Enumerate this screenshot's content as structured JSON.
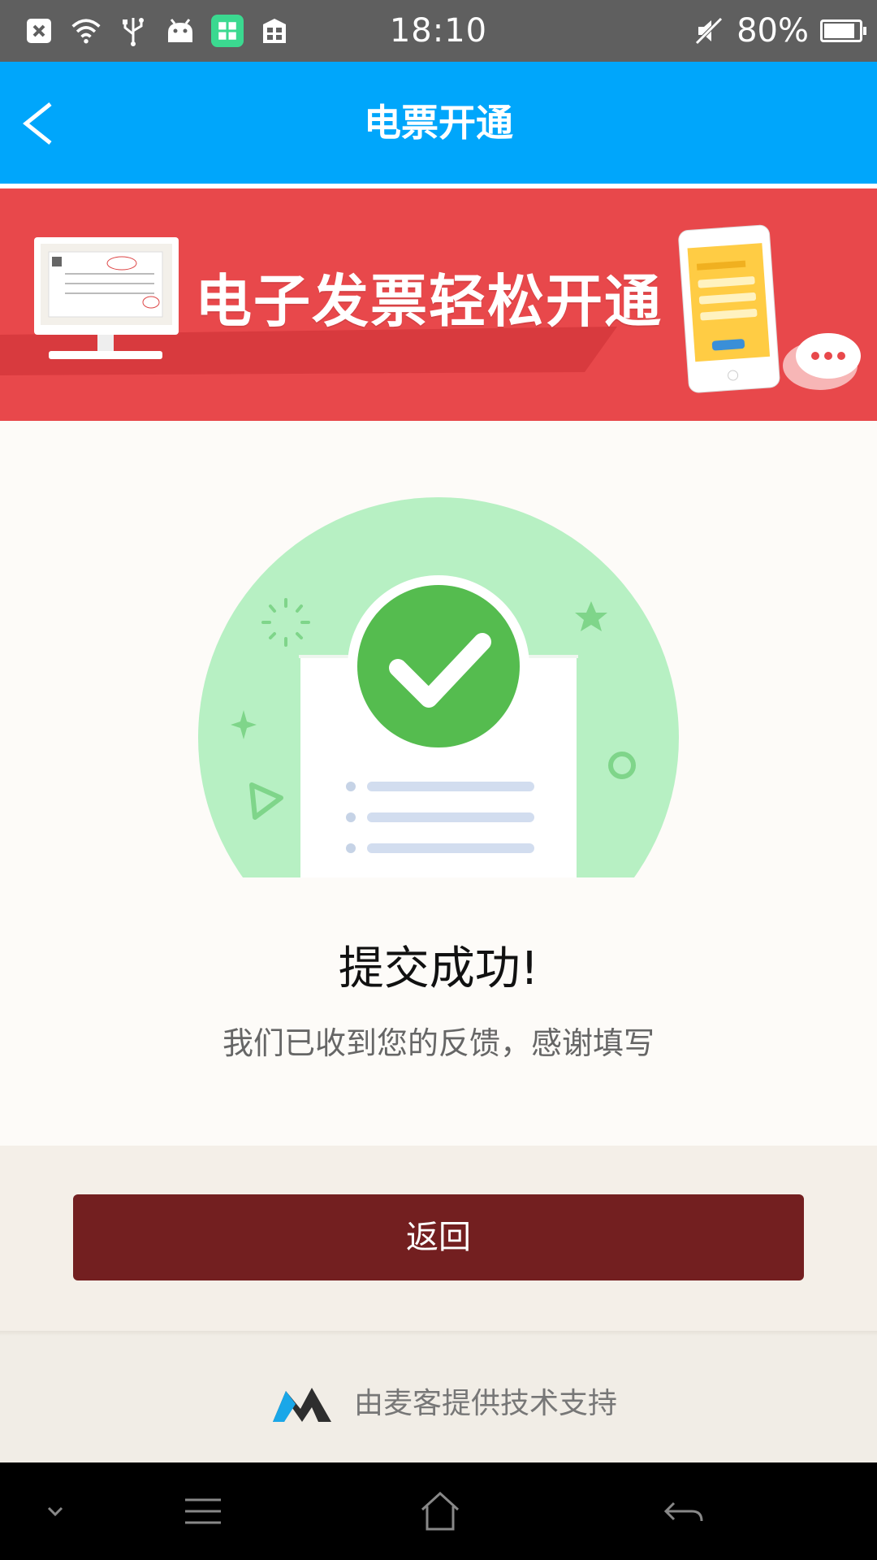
{
  "status_bar": {
    "time": "18:10",
    "battery_text": "80%",
    "battery_level": 0.8
  },
  "header": {
    "title": "电票开通"
  },
  "banner": {
    "headline": "电子发票轻松开通"
  },
  "result": {
    "title": "提交成功!",
    "message": "我们已收到您的反馈，感谢填写"
  },
  "actions": {
    "return_label": "返回"
  },
  "footer": {
    "provider_text": "由麦客提供技术支持"
  },
  "colors": {
    "header_bg": "#00a6fb",
    "banner_bg": "#e8484b",
    "success_green": "#55bc4f",
    "button_bg": "#731f20"
  }
}
